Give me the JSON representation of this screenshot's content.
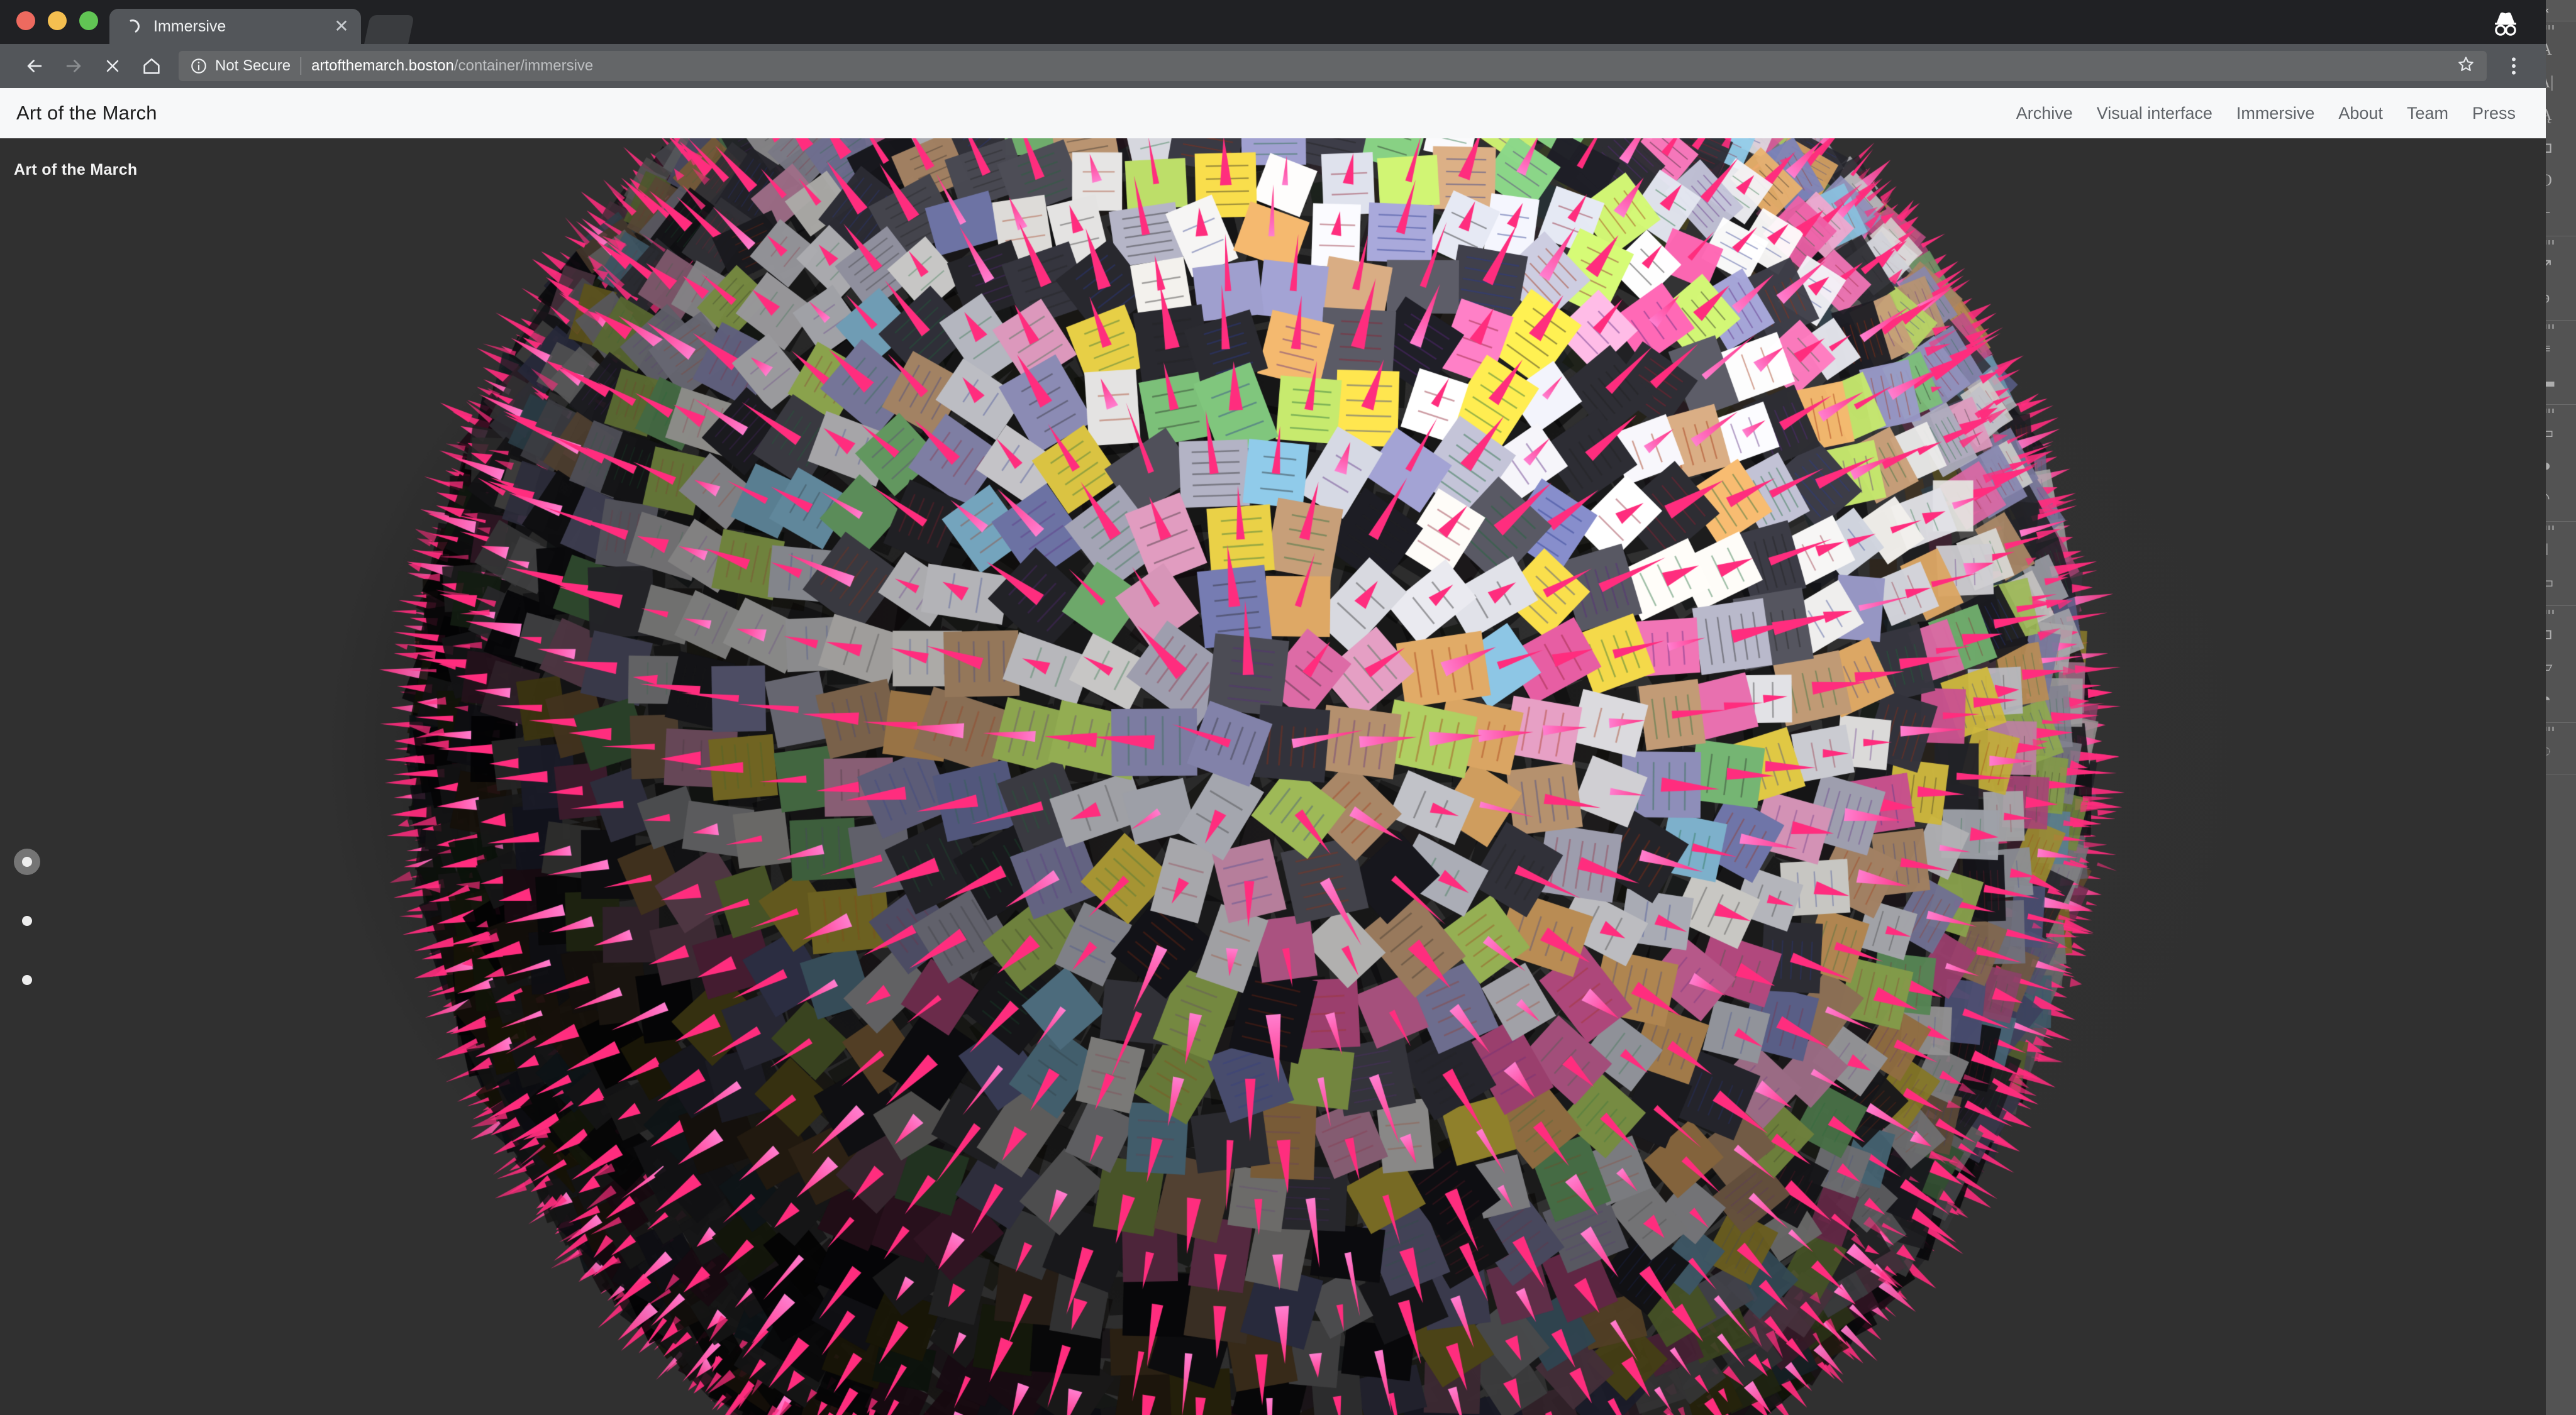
{
  "window": {
    "traffic_lights": [
      "close",
      "minimize",
      "maximize"
    ],
    "incognito_icon": "incognito-hat-glasses-icon"
  },
  "tabs": [
    {
      "title": "Immersive",
      "loading": true,
      "close_label": "✕",
      "active": true
    }
  ],
  "toolbar": {
    "back_label": "←",
    "forward_label": "→",
    "stop_label": "✕",
    "home_label": "⌂",
    "bookmark_label": "☆",
    "menu_label": "⋮"
  },
  "omnibox": {
    "security_icon": "info-circle-icon",
    "security_text": "Not Secure",
    "url_host": "artofthemarch.boston",
    "url_path": "/container/immersive",
    "full_url": "artofthemarch.boston/container/immersive"
  },
  "site": {
    "brand": "Art of the March",
    "nav": [
      {
        "label": "Archive"
      },
      {
        "label": "Visual interface"
      },
      {
        "label": "Immersive"
      },
      {
        "label": "About"
      },
      {
        "label": "Team"
      },
      {
        "label": "Press"
      }
    ]
  },
  "scene": {
    "overlay_title": "Art of the March",
    "description": "3D immersive sphere composed of protest-sign photographs with pink directional markers",
    "dots": [
      {
        "name": "view-dot-1",
        "active": true
      },
      {
        "name": "view-dot-2",
        "active": false
      },
      {
        "name": "view-dot-3",
        "active": false
      }
    ],
    "colors": {
      "marker_pink": "#ff2d7e",
      "marker_pink_light": "#ff7fd0",
      "background_dark": "#0a0a0a",
      "background_light": "#323232",
      "header_background": "#f7f8f9"
    }
  },
  "background_app": {
    "collapse_label": "«",
    "tool_groups": [
      {
        "tools": [
          "A",
          "A|",
          "Ą",
          "⊐",
          "O",
          "⌐"
        ]
      },
      {
        "tools": [
          "↗",
          "ǝ"
        ]
      },
      {
        "tools": [
          "≡",
          "▬"
        ]
      },
      {
        "tools": [
          "▭",
          "◑",
          "◝"
        ]
      },
      {
        "tools": [
          "‖",
          "▭"
        ]
      },
      {
        "tools": [
          "⊐",
          "▱",
          "◔"
        ]
      },
      {
        "tools": [
          "◌"
        ]
      }
    ]
  }
}
